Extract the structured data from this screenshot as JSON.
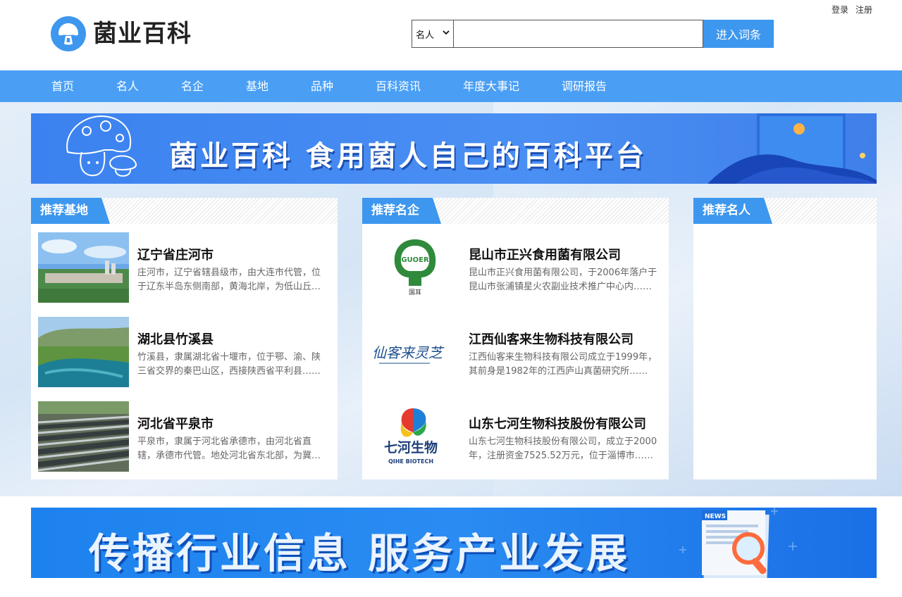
{
  "top_links": {
    "login": "登录",
    "register": "注册"
  },
  "logo": {
    "text": "菌业百科"
  },
  "search": {
    "category": "名人",
    "placeholder": "",
    "button": "进入词条"
  },
  "nav": {
    "items": [
      "首页",
      "名人",
      "名企",
      "基地",
      "品种",
      "百科资讯",
      "年度大事记",
      "调研报告"
    ]
  },
  "banner_top": {
    "text": "菌业百科 食用菌人自己的百科平台"
  },
  "panels": {
    "bases": {
      "title": "推荐基地",
      "items": [
        {
          "title": "辽宁省庄河市",
          "desc": "庄河市，辽宁省辖县级市，由大连市代管，位于辽东半岛东侧南部，黄海北岸，为低山丘陵区……"
        },
        {
          "title": "湖北县竹溪县",
          "desc": "竹溪县，隶属湖北省十堰市，位于鄂、渝、陕三省交界的秦巴山区，西接陕西省平利县……"
        },
        {
          "title": "河北省平泉市",
          "desc": "平泉市，隶属于河北省承德市，由河北省直辖，承德市代管。地处河北省东北部，为冀辽蒙三省区交界……"
        }
      ]
    },
    "companies": {
      "title": "推荐名企",
      "items": [
        {
          "title": "昆山市正兴食用菌有限公司",
          "desc": "昆山市正兴食用菌有限公司，于2006年落户于昆山市张浦镇星火农副业技术推广中心内……",
          "logo_text": "GUOER",
          "logo_sub": "国耳"
        },
        {
          "title": "江西仙客来生物科技有限公司",
          "desc": "江西仙客来生物科技有限公司成立于1999年，其前身是1982年的江西庐山真菌研究所……",
          "logo_text": "仙客来灵芝"
        },
        {
          "title": "山东七河生物科技股份有限公司",
          "desc": "山东七河生物科技股份有限公司，成立于2000年，注册资金7525.52万元，位于淄博市……",
          "logo_text": "七河生物",
          "logo_sub": "QIHE BIOTECH"
        }
      ]
    },
    "people": {
      "title": "推荐名人",
      "items": []
    }
  },
  "banner_bottom": {
    "text": "传播行业信息 服务产业发展",
    "badge": "NEWS"
  },
  "colors": {
    "brand": "#3d97ee",
    "nav": "#4a9ff5"
  }
}
